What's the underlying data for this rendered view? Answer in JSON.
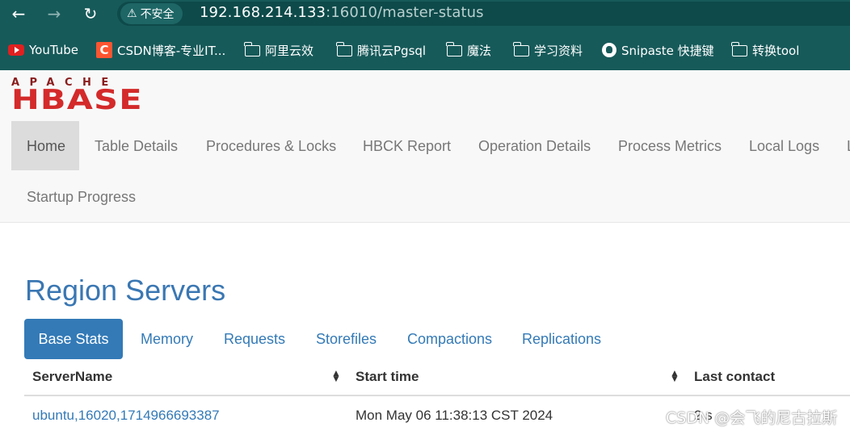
{
  "browser": {
    "security_label": "不安全",
    "url_host": "192.168.214.133",
    "url_rest": ":16010/master-status",
    "bookmarks": [
      {
        "label": "YouTube",
        "icon": "youtube-icon"
      },
      {
        "label": "CSDN博客-专业IT...",
        "icon": "csdn-icon"
      },
      {
        "label": "阿里云效",
        "icon": "folder-icon"
      },
      {
        "label": "腾讯云Pgsql",
        "icon": "folder-icon"
      },
      {
        "label": "魔法",
        "icon": "folder-icon"
      },
      {
        "label": "学习资料",
        "icon": "folder-icon"
      },
      {
        "label": "Snipaste 快捷键",
        "icon": "github-icon"
      },
      {
        "label": "转换tool",
        "icon": "folder-icon"
      }
    ]
  },
  "logo": {
    "top": "APACHE",
    "main": "HBASE"
  },
  "nav": {
    "items": [
      "Home",
      "Table Details",
      "Procedures & Locks",
      "HBCK Report",
      "Operation Details",
      "Process Metrics",
      "Local Logs",
      "L"
    ],
    "row2": [
      "Startup Progress"
    ],
    "active": "Home"
  },
  "section": {
    "title": "Region Servers"
  },
  "tabs": [
    "Base Stats",
    "Memory",
    "Requests",
    "Storefiles",
    "Compactions",
    "Replications"
  ],
  "table": {
    "headers": [
      "ServerName",
      "Start time",
      "Last contact"
    ],
    "rows": [
      {
        "server": "ubuntu,16020,1714966693387",
        "start": "Mon May 06 11:38:13 CST 2024",
        "last": "2 s"
      }
    ]
  },
  "watermark": "CSDN @会飞的尼古拉斯",
  "colors": {
    "browser_bg": "#175a5a",
    "link": "#337ab7",
    "tab_active": "#337ab7",
    "logo_red": "#d42a2a"
  }
}
